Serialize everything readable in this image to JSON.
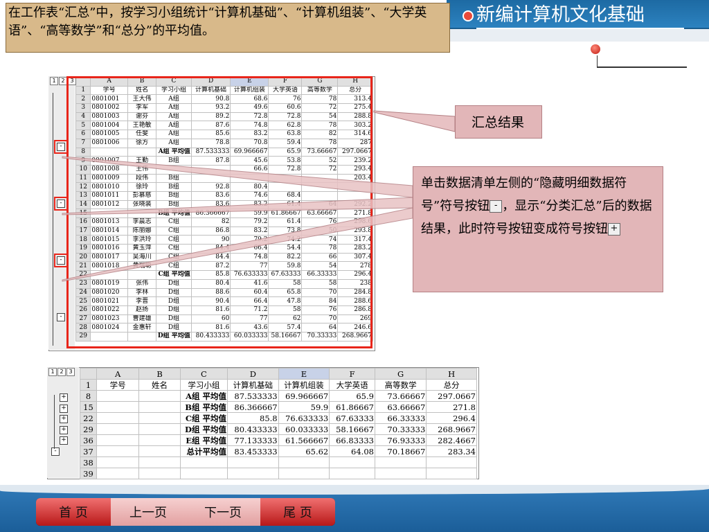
{
  "header": {
    "title": "新编计算机文化基础"
  },
  "instruction": "在工作表“汇总”中，按学习小组统计“计算机基础”、“计算机组装”、“大学英语”、“高等数学”和“总分”的平均值。",
  "sheet1": {
    "levels": [
      "1",
      "2",
      "3"
    ],
    "columns": [
      "A",
      "B",
      "C",
      "D",
      "E",
      "F",
      "G",
      "H"
    ],
    "header": [
      "学号",
      "姓名",
      "学习小组",
      "计算机基础",
      "计算机组装",
      "大学英语",
      "高等数学",
      "总分"
    ],
    "rows": [
      {
        "n": "2",
        "c": [
          "0801001",
          "王大伟",
          "A组",
          "90.8",
          "68.6",
          "76",
          "78",
          "313.4"
        ]
      },
      {
        "n": "3",
        "c": [
          "0801002",
          "李军",
          "A组",
          "93.2",
          "49.6",
          "60.6",
          "72",
          "275.4"
        ]
      },
      {
        "n": "4",
        "c": [
          "0801003",
          "谢芬",
          "A组",
          "89.2",
          "72.8",
          "72.8",
          "54",
          "288.8"
        ]
      },
      {
        "n": "5",
        "c": [
          "0801004",
          "王艳敏",
          "A组",
          "87.6",
          "74.8",
          "62.8",
          "78",
          "303.2"
        ]
      },
      {
        "n": "6",
        "c": [
          "0801005",
          "任斐",
          "A组",
          "85.6",
          "83.2",
          "63.8",
          "82",
          "314.6"
        ]
      },
      {
        "n": "7",
        "c": [
          "0801006",
          "徐方",
          "A组",
          "78.8",
          "70.8",
          "59.4",
          "78",
          "287"
        ]
      },
      {
        "n": "8",
        "c": [
          "",
          "",
          "A组 平均值",
          "87.533333",
          "69.966667",
          "65.9",
          "73.66667",
          "297.0667"
        ],
        "sub": true
      },
      {
        "n": "9",
        "c": [
          "0801007",
          "王勤",
          "B组",
          "87.8",
          "45.6",
          "53.8",
          "52",
          "239.2"
        ]
      },
      {
        "n": "10",
        "c": [
          "0801008",
          "王伟",
          "",
          "",
          "66.6",
          "72.8",
          "72",
          "293.4"
        ]
      },
      {
        "n": "11",
        "c": [
          "0801009",
          "段伟",
          "B组",
          "",
          "",
          "",
          "",
          "203.4"
        ]
      },
      {
        "n": "12",
        "c": [
          "0801010",
          "徐玲",
          "B组",
          "92.8",
          "80.4",
          "",
          "",
          ""
        ]
      },
      {
        "n": "13",
        "c": [
          "0801011",
          "彭慕慈",
          "B组",
          "83.6",
          "74.6",
          "68.4",
          "",
          ""
        ]
      },
      {
        "n": "14",
        "c": [
          "0801012",
          "张晓装",
          "B组",
          "83.6",
          "83.2",
          "61.4",
          "64",
          "292.2"
        ]
      },
      {
        "n": "15",
        "c": [
          "",
          "",
          "B组 平均值",
          "86.366667",
          "59.9",
          "61.86667",
          "63.66667",
          "271.8"
        ],
        "sub": true
      },
      {
        "n": "16",
        "c": [
          "0801013",
          "李晨志",
          "C组",
          "82",
          "79.2",
          "61.4",
          "76",
          "298.6"
        ]
      },
      {
        "n": "17",
        "c": [
          "0801014",
          "陈丽娜",
          "C组",
          "86.8",
          "83.2",
          "73.8",
          "50",
          "293.8"
        ]
      },
      {
        "n": "18",
        "c": [
          "0801015",
          "李洪玲",
          "C组",
          "90",
          "79.2",
          "74.2",
          "74",
          "317.4"
        ]
      },
      {
        "n": "19",
        "c": [
          "0801016",
          "黄玉萍",
          "C组",
          "84.4",
          "66.4",
          "54.4",
          "78",
          "283.2"
        ]
      },
      {
        "n": "20",
        "c": [
          "0801017",
          "吴海川",
          "C组",
          "84.4",
          "74.8",
          "82.2",
          "66",
          "307.4"
        ]
      },
      {
        "n": "21",
        "c": [
          "0801018",
          "黄瑞聪",
          "C组",
          "87.2",
          "77",
          "59.8",
          "54",
          "278"
        ]
      },
      {
        "n": "22",
        "c": [
          "",
          "",
          "C组 平均值",
          "85.8",
          "76.633333",
          "67.63333",
          "66.33333",
          "296.4"
        ],
        "sub": true
      },
      {
        "n": "23",
        "c": [
          "0801019",
          "张伟",
          "D组",
          "80.4",
          "41.6",
          "58",
          "58",
          "238"
        ]
      },
      {
        "n": "24",
        "c": [
          "0801020",
          "李林",
          "D组",
          "88.6",
          "60.4",
          "65.8",
          "70",
          "284.8"
        ]
      },
      {
        "n": "25",
        "c": [
          "0801021",
          "李晋",
          "D组",
          "90.4",
          "66.4",
          "47.8",
          "84",
          "288.6"
        ]
      },
      {
        "n": "26",
        "c": [
          "0801022",
          "赵扬",
          "D组",
          "81.6",
          "71.2",
          "58",
          "76",
          "286.8"
        ]
      },
      {
        "n": "27",
        "c": [
          "0801023",
          "曹建雄",
          "D组",
          "60",
          "77",
          "62",
          "70",
          "269"
        ]
      },
      {
        "n": "28",
        "c": [
          "0801024",
          "金惠轩",
          "D组",
          "81.6",
          "43.6",
          "57.4",
          "64",
          "246.6"
        ]
      },
      {
        "n": "29",
        "c": [
          "",
          "",
          "D组 平均值",
          "80.433333",
          "60.033333",
          "58.16667",
          "70.33333",
          "268.9667"
        ],
        "sub": true
      }
    ]
  },
  "sheet2": {
    "levels": [
      "1",
      "2",
      "3"
    ],
    "columns": [
      "A",
      "B",
      "C",
      "D",
      "E",
      "F",
      "G",
      "H"
    ],
    "header": [
      "学号",
      "姓名",
      "学习小组",
      "计算机基础",
      "计算机组装",
      "大学英语",
      "高等数学",
      "总分"
    ],
    "rows": [
      {
        "n": "8",
        "c": [
          "",
          "",
          "A组 平均值",
          "87.533333",
          "69.966667",
          "65.9",
          "73.66667",
          "297.0667"
        ]
      },
      {
        "n": "15",
        "c": [
          "",
          "",
          "B组 平均值",
          "86.366667",
          "59.9",
          "61.86667",
          "63.66667",
          "271.8"
        ]
      },
      {
        "n": "22",
        "c": [
          "",
          "",
          "C组 平均值",
          "85.8",
          "76.633333",
          "67.63333",
          "66.33333",
          "296.4"
        ]
      },
      {
        "n": "29",
        "c": [
          "",
          "",
          "D组 平均值",
          "80.433333",
          "60.033333",
          "58.16667",
          "70.33333",
          "268.9667"
        ]
      },
      {
        "n": "36",
        "c": [
          "",
          "",
          "E组 平均值",
          "77.133333",
          "61.566667",
          "66.83333",
          "76.93333",
          "282.4667"
        ]
      },
      {
        "n": "37",
        "c": [
          "",
          "",
          "总计平均值",
          "83.453333",
          "65.62",
          "64.08",
          "70.18667",
          "283.34"
        ]
      },
      {
        "n": "38",
        "c": [
          "",
          "",
          "",
          "",
          "",
          "",
          "",
          ""
        ]
      },
      {
        "n": "39",
        "c": [
          "",
          "",
          "",
          "",
          "",
          "",
          "",
          ""
        ]
      }
    ]
  },
  "callouts": {
    "summary": "汇总结果",
    "explain_part1": "单击数据清单左侧的“隐藏明细数据符号”符号按钮",
    "explain_part2": "，显示“分类汇总”后的数据结果，此时符号按钮变成符号按钮",
    "minus_sym": "-",
    "plus_sym": "+"
  },
  "nav": {
    "first": "首 页",
    "prev": "上一页",
    "next": "下一页",
    "last": "尾 页"
  }
}
